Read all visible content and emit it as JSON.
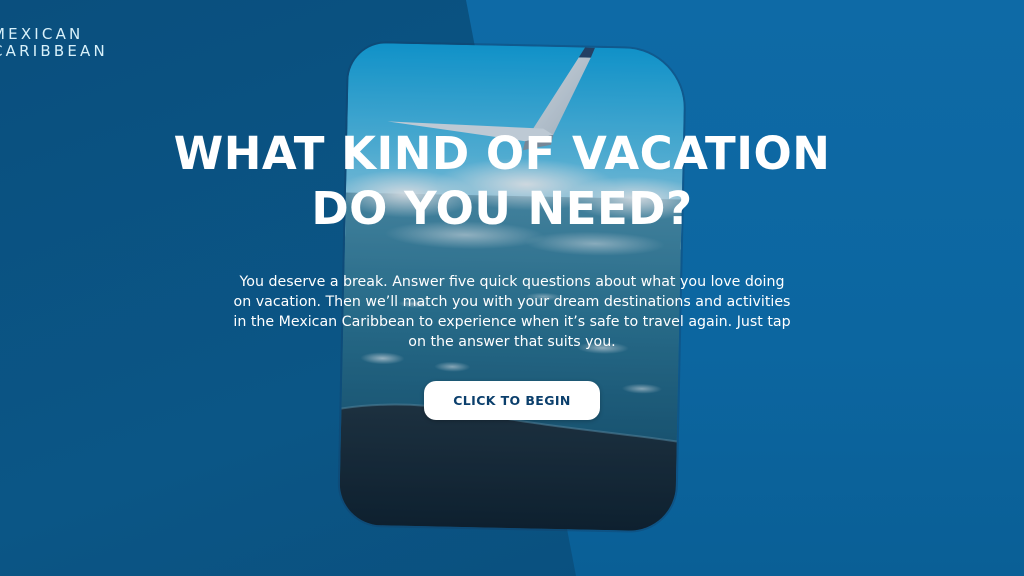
{
  "brand": {
    "line1": "MEXICAN",
    "line2": "CARIBBEAN"
  },
  "hero": {
    "title_line1": "WHAT KIND OF VACATION",
    "title_line2": "DO YOU NEED?",
    "intro": "You deserve a break. Answer five quick questions about what you love doing on vacation. Then we’ll match you with your dream destinations and activities in the Mexican Caribbean to experience when it’s safe to travel again. Just tap on the answer that suits you.",
    "cta_label": "CLICK TO BEGIN"
  },
  "colors": {
    "bg_left": "#0b5686",
    "bg_right": "#0c66a0",
    "sky": "#1da9e0",
    "sea": "#174a66",
    "button_text": "#0b3f6c"
  }
}
